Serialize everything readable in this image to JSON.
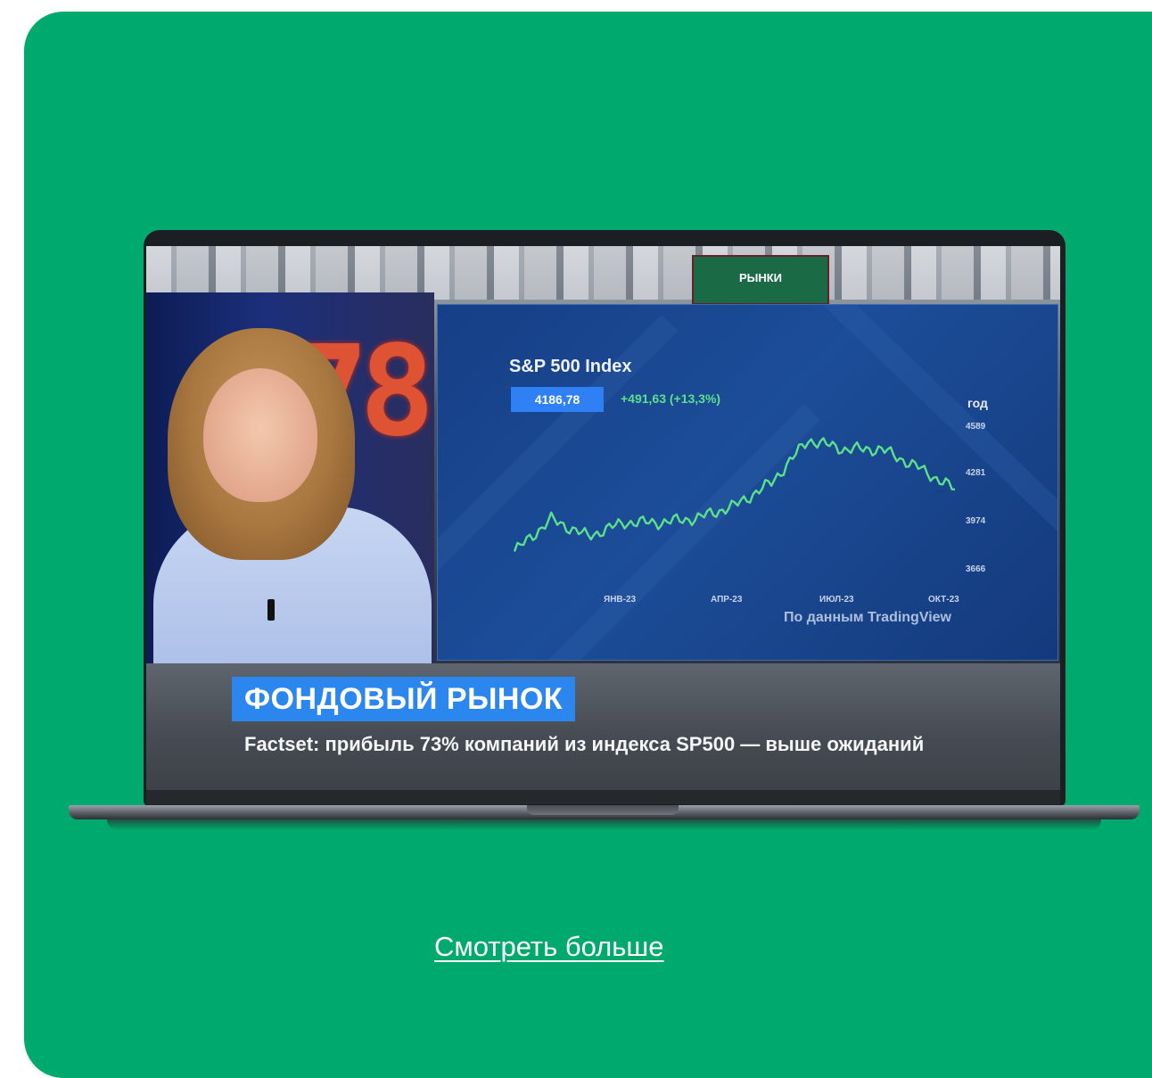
{
  "colors": {
    "card_bg": "#00aa6e",
    "price_badge": "#2f7ff5",
    "change_green": "#5ce08c",
    "headline_bg": "#2b86ee",
    "line_color": "#5ce08c"
  },
  "studio": {
    "logo_text": "РЫНКИ",
    "led_digits": "78"
  },
  "chart": {
    "title": "S&P 500 Index",
    "last_price": "4186,78",
    "change": "+491,63  (+13,3%)",
    "period": "год",
    "source": "По данным TradingView"
  },
  "chart_data": {
    "type": "line",
    "title": "S&P 500 Index",
    "y_ticks": [
      "4589",
      "4281",
      "3974",
      "3666"
    ],
    "x_ticks": [
      "ЯНВ-23",
      "АПР-23",
      "ИЮЛ-23",
      "ОКТ-23"
    ],
    "ylim": [
      3666,
      4589
    ],
    "x": [
      "2022-11",
      "2022-12",
      "2023-01",
      "2023-02",
      "2023-03",
      "2023-04",
      "2023-05",
      "2023-06",
      "2023-07",
      "2023-08",
      "2023-09",
      "2023-10",
      "2023-11"
    ],
    "series": [
      {
        "values": [
          3780,
          3990,
          3880,
          3970,
          3970,
          4000,
          4080,
          4230,
          4510,
          4450,
          4450,
          4330,
          4186.78
        ]
      }
    ]
  },
  "lower_third": {
    "headline": "ФОНДОВЫЙ РЫНОК",
    "ticker": "Factset: прибыль 73% компаний из индекса SP500 — выше ожиданий"
  },
  "cta": {
    "label": "Смотреть больше"
  }
}
